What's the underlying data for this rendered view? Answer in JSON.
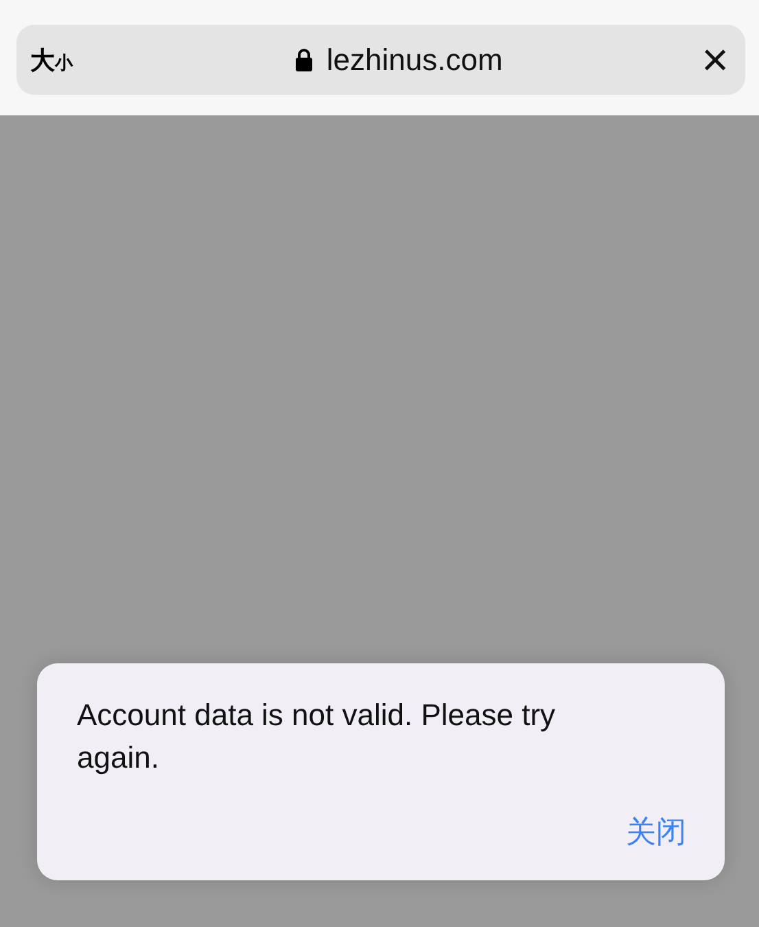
{
  "address_bar": {
    "text_size_button": "大小",
    "secure": true,
    "url": "lezhinus.com",
    "close_button": "×"
  },
  "alert": {
    "message": "Account data is not valid. Please try again.",
    "buttons": [
      "关闭"
    ]
  }
}
